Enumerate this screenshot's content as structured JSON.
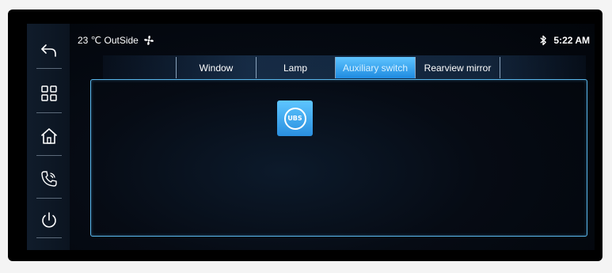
{
  "status": {
    "temperature": "23 ℃ OutSide",
    "fan_icon": "fan-icon",
    "bluetooth_icon": "bluetooth-icon",
    "time": "5:22 AM"
  },
  "sidebar": {
    "items": [
      {
        "name": "back",
        "icon": "back-arrow-icon"
      },
      {
        "name": "apps",
        "icon": "grid-icon"
      },
      {
        "name": "home",
        "icon": "home-icon"
      },
      {
        "name": "phone",
        "icon": "phone-icon"
      },
      {
        "name": "power",
        "icon": "power-icon"
      }
    ]
  },
  "tabs": [
    {
      "label": "Window",
      "active": false
    },
    {
      "label": "Lamp",
      "active": false
    },
    {
      "label": "Auxiliary switch",
      "active": true
    },
    {
      "label": "Rearview mirror",
      "active": false
    }
  ],
  "content": {
    "button_text": "UBS",
    "button_icon": "ubs-icon"
  },
  "colors": {
    "accent": "#3aa8f0",
    "panel_border": "#59b6ea",
    "background": "#000000"
  }
}
